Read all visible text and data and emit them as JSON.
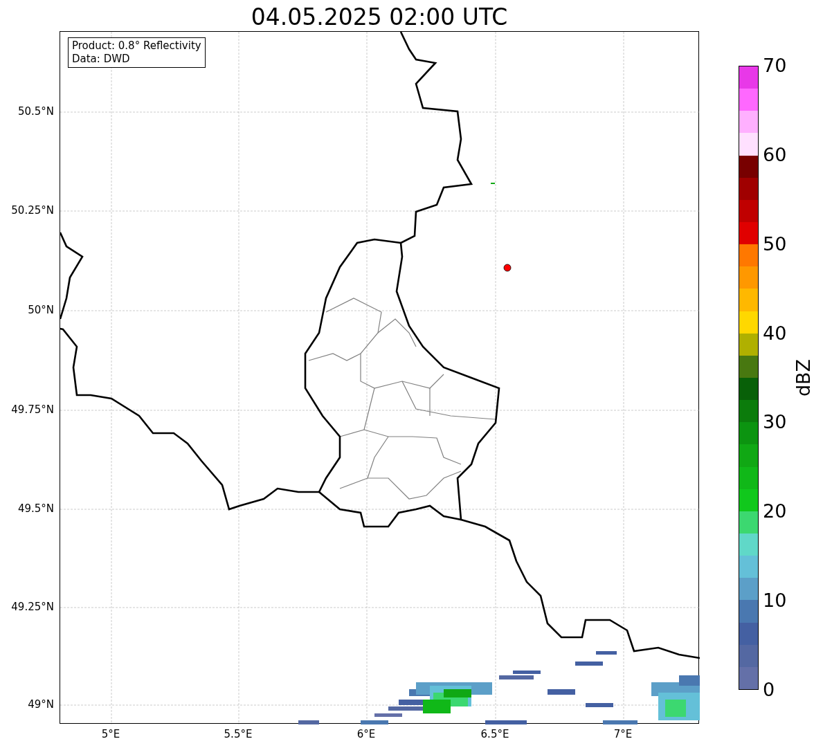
{
  "title": "04.05.2025 02:00 UTC",
  "info_box": [
    "Product: 0.8° Reflectivity",
    "Data: DWD"
  ],
  "map": {
    "y_ticks": [
      "50.5°N",
      "50.25°N",
      "50°N",
      "49.75°N",
      "49.5°N",
      "49.25°N",
      "49°N"
    ],
    "x_ticks": [
      "5°E",
      "5.5°E",
      "6°E",
      "6.5°E",
      "7°E"
    ]
  },
  "colorbar": {
    "label": "dBZ",
    "ticks": [
      "70",
      "60",
      "50",
      "40",
      "30",
      "20",
      "10",
      "0"
    ],
    "bands": [
      {
        "color": "#6470a8"
      },
      {
        "color": "#5468a2"
      },
      {
        "color": "#4460a2"
      },
      {
        "color": "#4a78b0"
      },
      {
        "color": "#5c9fc8"
      },
      {
        "color": "#64c0d8"
      },
      {
        "color": "#60d8c8"
      },
      {
        "color": "#3cd870"
      },
      {
        "color": "#10c81c"
      },
      {
        "color": "#10b818"
      },
      {
        "color": "#10a814"
      },
      {
        "color": "#0c9410"
      },
      {
        "color": "#0c7c0c"
      },
      {
        "color": "#086008"
      },
      {
        "color": "#487810"
      },
      {
        "color": "#b0b000"
      },
      {
        "color": "#ffd800"
      },
      {
        "color": "#ffb800"
      },
      {
        "color": "#ff9800"
      },
      {
        "color": "#ff7800"
      },
      {
        "color": "#e00000"
      },
      {
        "color": "#c00000"
      },
      {
        "color": "#a00000"
      },
      {
        "color": "#780000"
      },
      {
        "color": "#ffe0ff"
      },
      {
        "color": "#ffb0ff"
      },
      {
        "color": "#ff68ff"
      },
      {
        "color": "#e838e8"
      }
    ]
  }
}
